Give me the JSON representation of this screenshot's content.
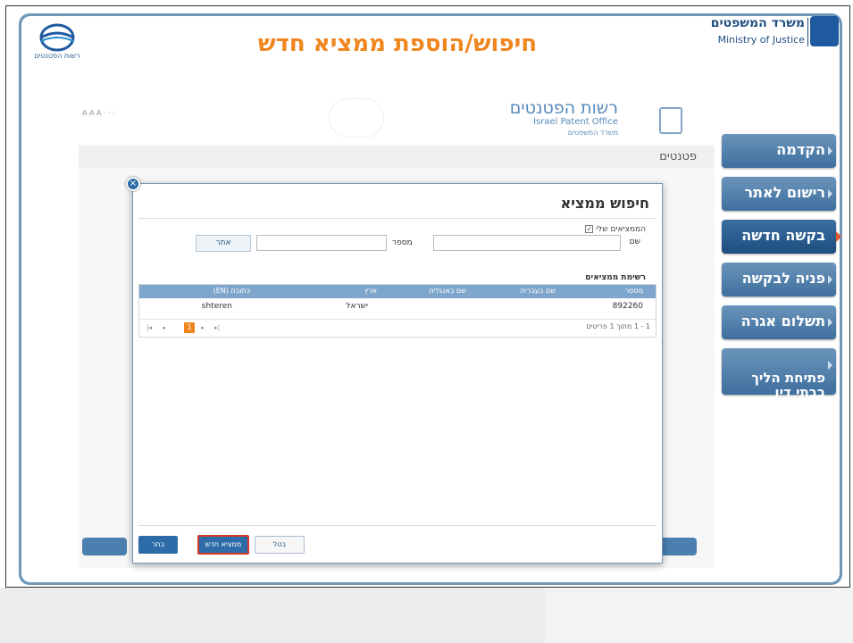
{
  "slide": {
    "title": "חיפוש/הוספת ממציא חדש",
    "logo_label": "רשות הפטנטים",
    "moj_hebrew": "משרד המשפטים",
    "moj_english": "Ministry of Justice"
  },
  "nav": {
    "items": [
      {
        "label": "הקדמה"
      },
      {
        "label": "רישום לאתר"
      },
      {
        "label": "בקשה חדשה"
      },
      {
        "label": "פניה לבקשה"
      },
      {
        "label": "תשלום אגרה"
      },
      {
        "label": "פתיחת הליך\nבבתי דין"
      }
    ]
  },
  "app": {
    "ipo_hebrew": "רשות הפטנטים",
    "ipo_english": "Israel Patent Office",
    "ipo_ministry": "משרד המשפטים",
    "section_title": "פטנטים"
  },
  "dialog": {
    "title": "חיפוש ממציא",
    "my_inventors_checkbox": "הממציאים שלי",
    "name_label": "שם",
    "number_label": "מספר",
    "find_button": "אתר",
    "list_title": "רשימת ממציאים",
    "columns": [
      "מספר",
      "שם בעברית",
      "שם באנגלית",
      "ארץ",
      "כתובת (EN)"
    ],
    "rows": [
      {
        "number": "892260",
        "name_he": "",
        "name_en": "",
        "country": "ישראל",
        "address_en": "shteren"
      }
    ],
    "pager": {
      "current_page": "1",
      "info": "1 - 1 מתוך 1 פריטים"
    },
    "choose_button": "בחר",
    "new_inventor_button": "ממציא חדש",
    "cancel_button": "בטל"
  }
}
